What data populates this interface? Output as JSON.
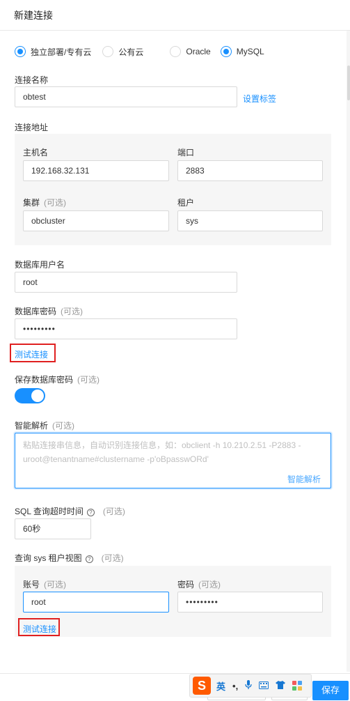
{
  "header": {
    "title": "新建连接"
  },
  "env_options": [
    {
      "label": "独立部署/专有云",
      "checked": true
    },
    {
      "label": "公有云",
      "checked": false
    },
    {
      "label": "Oracle",
      "checked": false
    },
    {
      "label": "MySQL",
      "checked": true
    }
  ],
  "conn_name": {
    "label": "连接名称",
    "value": "obtest",
    "tag_link": "设置标签"
  },
  "address": {
    "label": "连接地址",
    "host": {
      "label": "主机名",
      "value": "192.168.32.131"
    },
    "port": {
      "label": "端口",
      "value": "2883"
    },
    "cluster": {
      "label": "集群",
      "optional": "(可选)",
      "value": "obcluster"
    },
    "tenant": {
      "label": "租户",
      "value": "sys"
    }
  },
  "db_user": {
    "label": "数据库用户名",
    "value": "root"
  },
  "db_password": {
    "label": "数据库密码",
    "optional": "(可选)",
    "value": "•••••••••"
  },
  "test_connection_1": "测试连接",
  "save_password": {
    "label": "保存数据库密码",
    "optional": "(可选)",
    "on": true
  },
  "smart_parse": {
    "label": "智能解析",
    "optional": "(可选)",
    "placeholder": "粘贴连接串信息，自动识别连接信息，如：obclient -h 10.210.2.51 -P2883 -uroot@tenantname#clustername -p'oBpasswORd'",
    "action": "智能解析"
  },
  "sql_timeout": {
    "label": "SQL 查询超时时间",
    "help_icon": "question-circle-icon",
    "optional": "(可选)",
    "value": "60秒"
  },
  "sys_view": {
    "label": "查询 sys 租户视图",
    "help_icon": "question-circle-icon",
    "optional": "(可选)",
    "account": {
      "label": "账号",
      "optional": "(可选)",
      "value": "root"
    },
    "password": {
      "label": "密码",
      "optional": "(可选)",
      "value": "•••••••••"
    },
    "test_connection": "测试连接"
  },
  "footer": {
    "save_label": "保存"
  },
  "ime_toolbar": {
    "logo": "S",
    "lang": "英",
    "punct": "•,",
    "icons": [
      "microphone-icon",
      "keyboard-icon",
      "shirt-icon",
      "apps-grid-icon"
    ]
  },
  "colors": {
    "accent": "#1890ff",
    "highlight": "#e02020",
    "ime_brand": "#ff5a00"
  }
}
